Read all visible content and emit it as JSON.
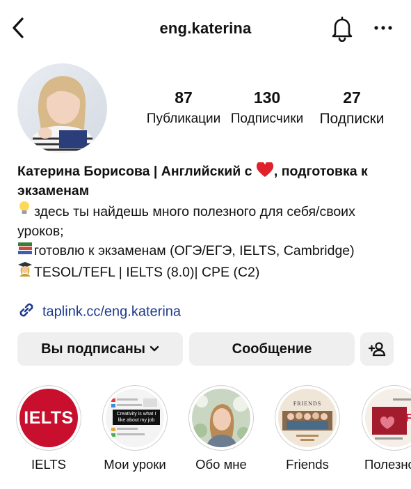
{
  "header": {
    "username": "eng.katerina"
  },
  "stats": [
    {
      "value": "87",
      "label": "Публикации"
    },
    {
      "value": "130",
      "label": "Подписчики"
    },
    {
      "value": "27",
      "label": "Подписки"
    }
  ],
  "bio": {
    "name_before_heart": "Катерина Борисова | Английский с",
    "name_after_heart": ", подготовка к экзаменам",
    "line1": "здесь ты найдешь много полезного для себя/своих уроков;",
    "line2": "готовлю к экзаменам (ОГЭ/ЕГЭ, IELTS, Cambridge)",
    "line3": "TESOL/TEFL | IELTS (8.0)| CPE (C2)",
    "link": "taplink.cc/eng.katerina"
  },
  "actions": {
    "follow_label": "Вы подписаны",
    "message_label": "Сообщение"
  },
  "highlights": [
    {
      "label": "IELTS",
      "cover_text": "IELTS"
    },
    {
      "label": "Мои уроки",
      "cover_text": "Creativity is what I like about my job"
    },
    {
      "label": "Обо мне"
    },
    {
      "label": "Friends",
      "cover_text": "FRIENDS"
    },
    {
      "label": "Полезное",
      "cover_text": "FR"
    }
  ],
  "colors": {
    "ielts_red": "#c8102e",
    "link_blue": "#1d3b8c",
    "button_gray": "#efefef"
  }
}
